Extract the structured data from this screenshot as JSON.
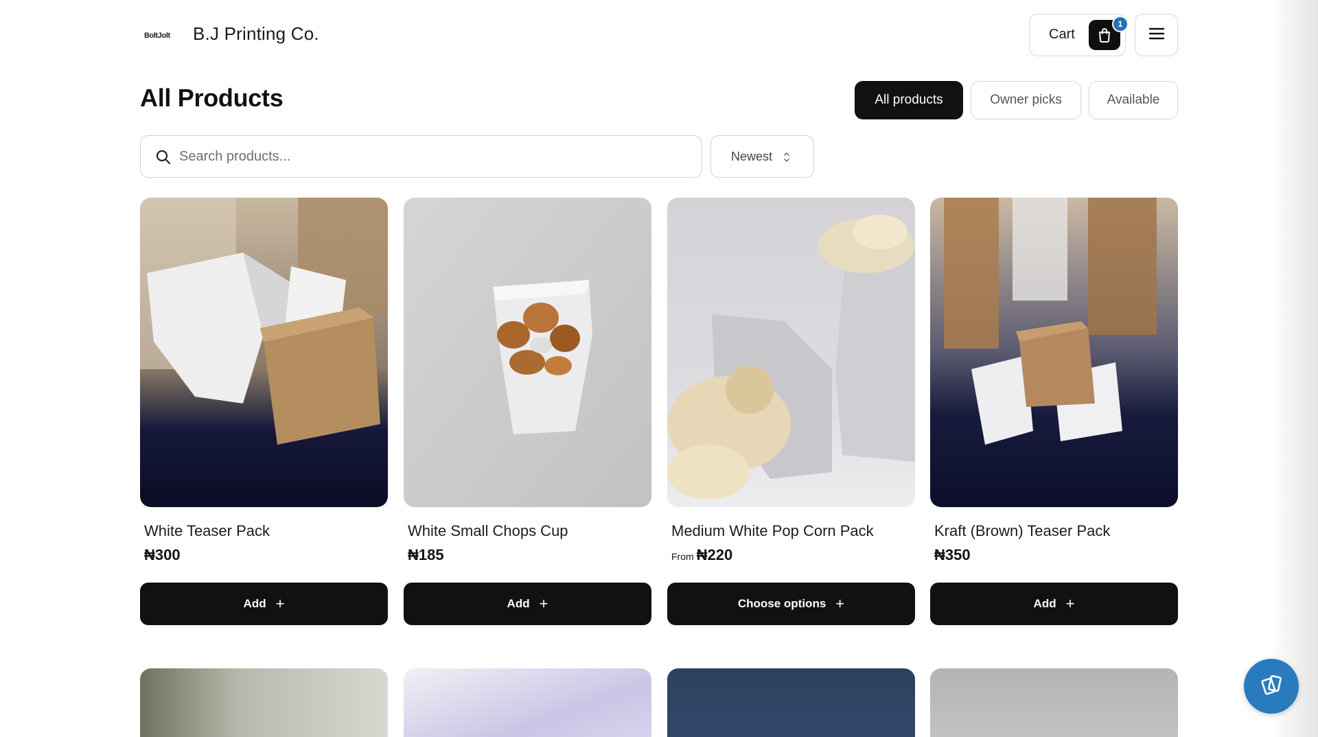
{
  "header": {
    "logo_text": "BoltJolt",
    "brand": "B.J Printing Co.",
    "cart_label": "Cart",
    "cart_count": "1",
    "cart_icon": "shopping-bag-icon",
    "menu_icon": "hamburger-menu-icon"
  },
  "page": {
    "title": "All Products",
    "filters": [
      {
        "label": "All products",
        "active": true
      },
      {
        "label": "Owner picks",
        "active": false
      },
      {
        "label": "Available",
        "active": false
      }
    ]
  },
  "search": {
    "placeholder": "Search products...",
    "icon": "search-icon"
  },
  "sort": {
    "selected": "Newest",
    "icon": "up-down-chevron-icon"
  },
  "products": [
    {
      "name": "White Teaser Pack",
      "price": "₦300",
      "price_prefix": "",
      "button": "Add"
    },
    {
      "name": "White Small Chops Cup",
      "price": "₦185",
      "price_prefix": "",
      "button": "Add"
    },
    {
      "name": "Medium White Pop Corn Pack",
      "price": "₦220",
      "price_prefix": "From",
      "button": "Choose options"
    },
    {
      "name": "Kraft (Brown) Teaser Pack",
      "price": "₦350",
      "price_prefix": "",
      "button": "Add"
    }
  ],
  "colors": {
    "primary": "#111111",
    "accent": "#2a7bbd",
    "badge": "#2373b6",
    "border": "#d7d7d7"
  },
  "chat_fab_icon": "chat-cards-icon"
}
